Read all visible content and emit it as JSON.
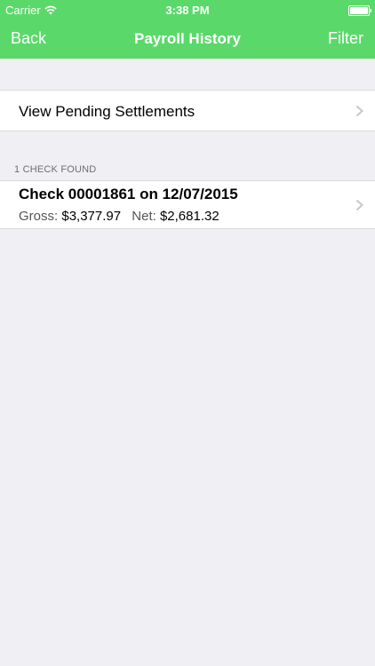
{
  "status": {
    "carrier": "Carrier",
    "time": "3:38 PM"
  },
  "nav": {
    "back": "Back",
    "title": "Payroll History",
    "filter": "Filter"
  },
  "pending": {
    "label": "View Pending Settlements"
  },
  "section": {
    "header": "1 CHECK FOUND"
  },
  "checks": [
    {
      "title": "Check 00001861 on 12/07/2015",
      "gross_label": "Gross:",
      "gross_value": "$3,377.97",
      "net_label": "Net:",
      "net_value": "$2,681.32"
    }
  ],
  "colors": {
    "accent": "#5ad96a",
    "background": "#efeff4"
  }
}
